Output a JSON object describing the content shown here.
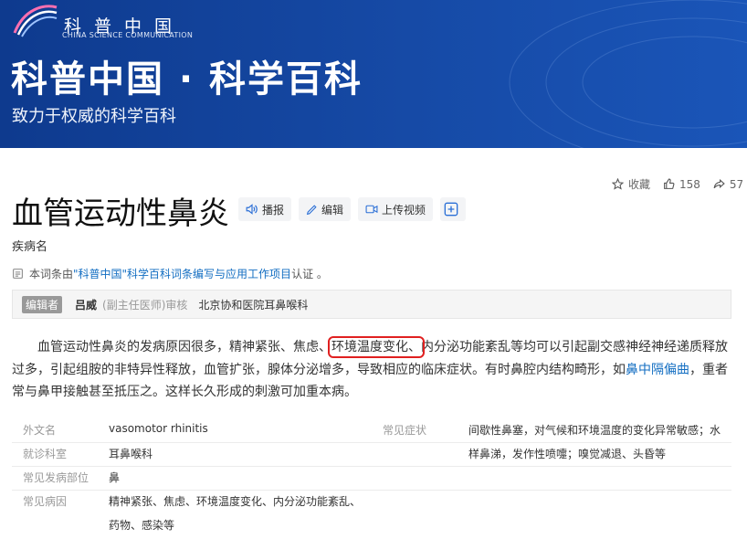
{
  "header": {
    "logo_cn": "科普中国",
    "logo_en": "CHINA SCIENCE COMMUNICATION",
    "site_title": "科普中国 · 科学百科",
    "site_subtitle": "致力于权威的科学百科"
  },
  "actions": {
    "favorite": "收藏",
    "likes": "158",
    "share": "57"
  },
  "entry": {
    "title": "血管运动性鼻炎",
    "subtitle": "疾病名",
    "tools": {
      "broadcast": "播报",
      "edit": "编辑",
      "upload_video": "上传视频"
    }
  },
  "certification": {
    "prefix": "本词条由",
    "link": "\"科普中国\"科学百科词条编写与应用工作项目",
    "suffix": " 认证 。"
  },
  "editor": {
    "tag": "编辑者",
    "name": "吕威",
    "role": "(副主任医师)审核",
    "org": "北京协和医院耳鼻喉科"
  },
  "summary": {
    "part1": "血管运动性鼻炎的发病原因很多，精神紧张、焦虑、",
    "highlight": "环境温度变化、",
    "part2": "内分泌功能紊乱等均可以引起副交感神经神经递质释放过多，引起组胺的非特异性释放，血管扩张，腺体分泌增多，导致相应的临床症状。有时鼻腔内结构畸形，如",
    "link": "鼻中隔偏曲",
    "part3": "，重者常与鼻甲接触甚至抵压之。这样长久形成的刺激可加重本病。"
  },
  "info": {
    "foreign_name_label": "外文名",
    "foreign_name": "vasomotor rhinitis",
    "department_label": "就诊科室",
    "department": "耳鼻喉科",
    "site_label": "常见发病部位",
    "site": "鼻",
    "cause_label": "常见病因",
    "cause_line1": "精神紧张、焦虑、环境温度变化、内分泌功能紊乱、",
    "cause_line2": "药物、感染等",
    "symptom_label": "常见症状",
    "symptom_line1": "间歇性鼻塞，对气候和环境温度的变化异常敏感；水",
    "symptom_line2": "样鼻涕，发作性喷嚏；嗅觉减退、头昏等"
  }
}
